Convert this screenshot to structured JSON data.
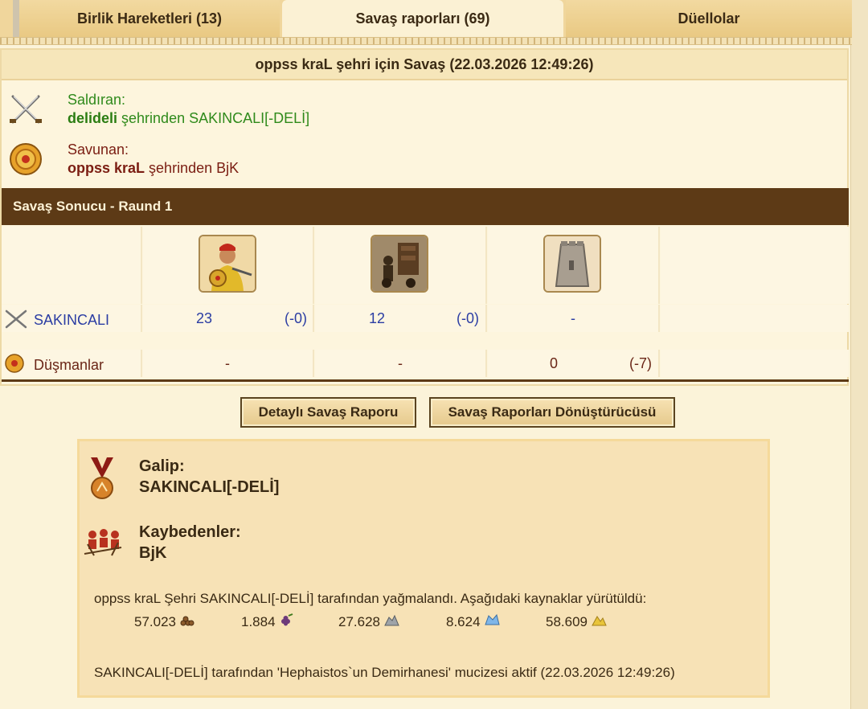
{
  "tabs": {
    "movements": "Birlik Hareketleri (13)",
    "reports": "Savaş raporları (69)",
    "duels": "Düellolar"
  },
  "report": {
    "title": "oppss kraL şehri için Savaş (22.03.2026 12:49:26)",
    "attacker_label": "Saldıran:",
    "attacker_player": "delideli",
    "attacker_suffix": "şehrinden SAKINCALI[-DELİ]",
    "defender_label": "Savunan:",
    "defender_player": "oppss kraL",
    "defender_suffix": "şehrinden BjK",
    "round_title": "Savaş Sonucu - Raund 1"
  },
  "table": {
    "units": [
      "hoplite-unit-icon",
      "catapult-unit-icon",
      "wall-unit-icon"
    ],
    "attacker_row": {
      "label": "SAKINCALI",
      "u1_count": "23",
      "u1_loss": "(-0)",
      "u2_count": "12",
      "u2_loss": "(-0)",
      "u3": "-"
    },
    "defender_row": {
      "label": "Düşmanlar",
      "u1": "-",
      "u2": "-",
      "u3_count": "0",
      "u3_loss": "(-7)"
    }
  },
  "buttons": {
    "detailed": "Detaylı Savaş Raporu",
    "converter": "Savaş Raporları Dönüştürücüsü"
  },
  "summary": {
    "winner_label": "Galip:",
    "winner": "SAKINCALI[-DELİ]",
    "losers_label": "Kaybedenler:",
    "losers": "BjK",
    "loot_text": "oppss kraL Şehri SAKINCALI[-DELİ] tarafından yağmalandı. Aşağıdaki kaynaklar yürütüldü:",
    "resources": [
      {
        "value": "57.023",
        "icon": "wood-icon"
      },
      {
        "value": "1.884",
        "icon": "wine-icon"
      },
      {
        "value": "27.628",
        "icon": "marble-icon"
      },
      {
        "value": "8.624",
        "icon": "crystal-icon"
      },
      {
        "value": "58.609",
        "icon": "sulfur-icon"
      }
    ],
    "wonder_text": "SAKINCALI[-DELİ] tarafından 'Hephaistos`un Demirhanesi' mucizesi aktif (22.03.2026 12:49:26)"
  }
}
